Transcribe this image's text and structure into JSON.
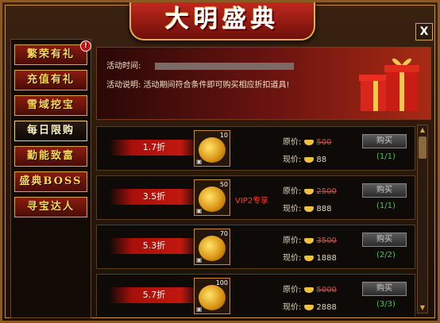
{
  "window": {
    "title": "大明盛典",
    "close_label": "X"
  },
  "sidebar": {
    "items": [
      {
        "label": "繁荣有礼",
        "badge": "!"
      },
      {
        "label": "充值有礼"
      },
      {
        "label": "雪域挖宝"
      },
      {
        "label": "每日限购",
        "active": true
      },
      {
        "label": "勤能致富"
      },
      {
        "label": "盛典BOSS"
      },
      {
        "label": "寻宝达人"
      }
    ]
  },
  "banner": {
    "time_label": "活动时间:",
    "desc_label": "活动说明:",
    "desc_text": "活动期间符合条件即可购买相应折扣道具!",
    "gift_icon": "gift-box-icon"
  },
  "labels": {
    "original_price": "原价:",
    "current_price": "现价:",
    "buy": "购买"
  },
  "items": [
    {
      "discount": "1.7折",
      "qty": "10",
      "original": "500",
      "current": "88",
      "limit": "(1/1)",
      "vip": ""
    },
    {
      "discount": "3.5折",
      "qty": "50",
      "original": "2500",
      "current": "888",
      "limit": "(1/1)",
      "vip": "VIP2专享"
    },
    {
      "discount": "5.3折",
      "qty": "70",
      "original": "3500",
      "current": "1888",
      "limit": "(2/2)",
      "vip": ""
    },
    {
      "discount": "5.7折",
      "qty": "100",
      "original": "5000",
      "current": "2888",
      "limit": "(3/3)",
      "vip": ""
    }
  ],
  "colors": {
    "accent_gold": "#d9a640",
    "discount_red": "#c21810",
    "limit_green": "#3ad03a"
  }
}
